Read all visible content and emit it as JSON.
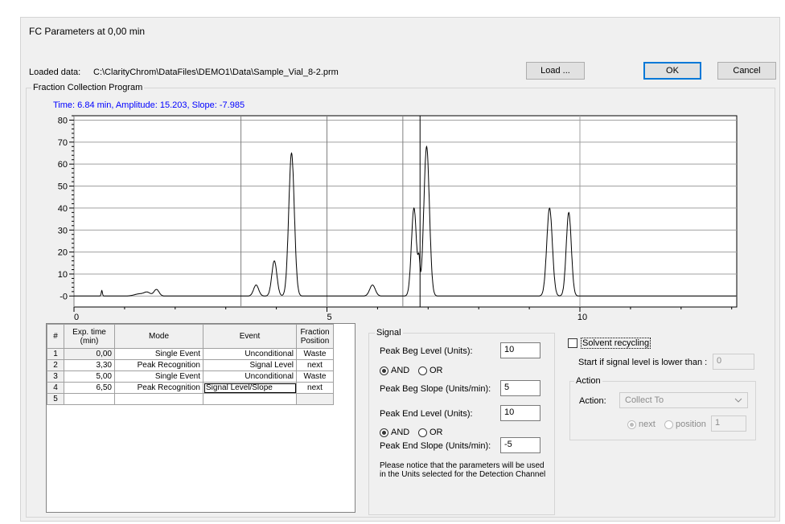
{
  "dialog": {
    "title": "FC Parameters at 0,00 min",
    "loaded_label": "Loaded data:",
    "loaded_path": "C:\\ClarityChrom\\DataFiles\\DEMO1\\Data\\Sample_Vial_8-2.prm",
    "load_button": "Load ...",
    "ok_button": "OK",
    "cancel_button": "Cancel"
  },
  "program": {
    "group_label": "Fraction Collection Program",
    "status": "Time: 6.84 min, Amplitude: 15.203, Slope: -7.985"
  },
  "chart_data": {
    "type": "line",
    "xlim": [
      0,
      13.1
    ],
    "ylim": [
      -5,
      82
    ],
    "x_ticks": [
      0,
      5,
      10
    ],
    "x_tick_labels": [
      "0",
      "5",
      "10"
    ],
    "y_ticks": [
      0,
      10,
      20,
      30,
      40,
      50,
      60,
      70,
      80
    ],
    "y_tick_labels": [
      "-0",
      "10",
      "20",
      "30",
      "40",
      "50",
      "60",
      "70",
      "80"
    ],
    "grid": true,
    "cursor_x": 6.84,
    "fraction_event_times": [
      0,
      3.3,
      5,
      6.5
    ],
    "series": [
      {
        "peaks": [
          {
            "t": 0.55,
            "h": 2.5,
            "w": 0.012
          },
          {
            "t": 1.3,
            "h": 1.0,
            "w": 0.1
          },
          {
            "t": 1.45,
            "h": 1.5,
            "w": 0.06
          },
          {
            "t": 1.63,
            "h": 3.0,
            "w": 0.05
          },
          {
            "t": 3.6,
            "h": 5.0,
            "w": 0.05
          },
          {
            "t": 3.96,
            "h": 16.0,
            "w": 0.05
          },
          {
            "t": 4.3,
            "h": 65.0,
            "w": 0.055
          },
          {
            "t": 5.9,
            "h": 5.0,
            "w": 0.055
          },
          {
            "t": 6.72,
            "h": 40.0,
            "w": 0.05
          },
          {
            "t": 6.82,
            "h": 12.0,
            "w": 0.02
          },
          {
            "t": 6.97,
            "h": 68.0,
            "w": 0.055
          },
          {
            "t": 9.4,
            "h": 40.0,
            "w": 0.055
          },
          {
            "t": 9.78,
            "h": 38.0,
            "w": 0.05
          }
        ]
      }
    ]
  },
  "table": {
    "headers": [
      "#",
      "Exp. time (min)",
      "Mode",
      "Event",
      "Fraction Position"
    ],
    "rows": [
      [
        "1",
        "0,00",
        "Single Event",
        "Unconditional",
        "Waste"
      ],
      [
        "2",
        "3,30",
        "Peak Recognition",
        "Signal Level",
        "next"
      ],
      [
        "3",
        "5,00",
        "Single Event",
        "Unconditional",
        "Waste"
      ],
      [
        "4",
        "6,50",
        "Peak Recognition",
        "Signal Level/Slope",
        "next"
      ],
      [
        "5",
        "",
        "",
        "",
        ""
      ]
    ]
  },
  "signal": {
    "group_label": "Signal",
    "peak_beg_level_label": "Peak Beg Level (Units):",
    "peak_beg_level_value": "10",
    "and_label": "AND",
    "or_label": "OR",
    "peak_beg_slope_label": "Peak Beg Slope (Units/min):",
    "peak_beg_slope_value": "5",
    "peak_end_level_label": "Peak End Level (Units):",
    "peak_end_level_value": "10",
    "and2_label": "AND",
    "or2_label": "OR",
    "peak_end_slope_label": "Peak End Slope (Units/min):",
    "peak_end_slope_value": "-5",
    "note": "Please notice that the parameters will be used in the Units selected for the Detection Channel"
  },
  "recycling": {
    "checkbox_label": "Solvent recycling",
    "start_label": "Start if signal level is lower than :",
    "start_value": "0",
    "action_group_label": "Action",
    "action_label": "Action:",
    "action_value": "Collect To",
    "next_label": "next",
    "position_label": "position",
    "position_value": "1"
  }
}
